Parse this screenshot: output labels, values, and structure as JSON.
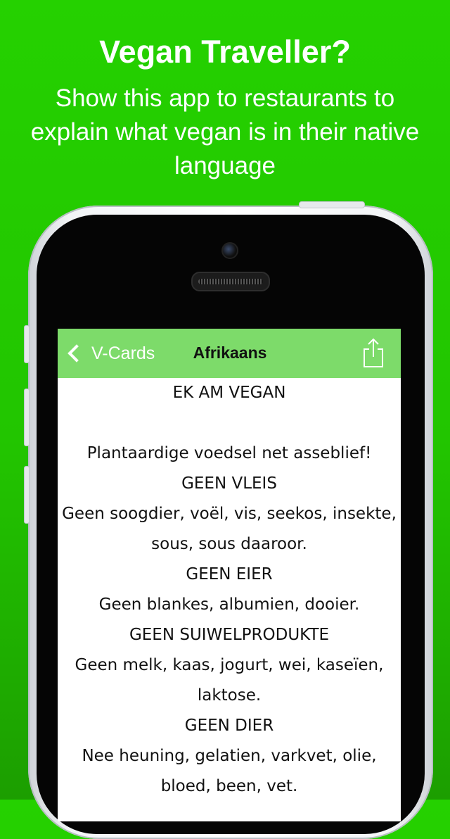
{
  "promo": {
    "headline": "Vegan Traveller?",
    "subline": "Show this app to restaurants to explain what vegan is in their native language"
  },
  "navbar": {
    "back_label": "V-Cards",
    "title": "Afrikaans",
    "share_icon": "share-icon",
    "color": "#7ddb6a"
  },
  "card": {
    "heading": "EK AM VEGAN",
    "lines": [
      "Plantaardige voedsel net asseblief!",
      "GEEN VLEIS",
      "Geen soogdier, voël, vis, seekos, insekte, sous, sous daaroor.",
      "GEEN EIER",
      "Geen blankes, albumien, dooier.",
      "GEEN SUIWELPRODUKTE",
      "Geen melk, kaas, jogurt, wei, kaseïen, laktose.",
      "GEEN DIER",
      "Nee heuning, gelatien, varkvet, olie, bloed, been, vet."
    ]
  },
  "colors": {
    "background": "#22c500",
    "text": "#ffffff"
  }
}
